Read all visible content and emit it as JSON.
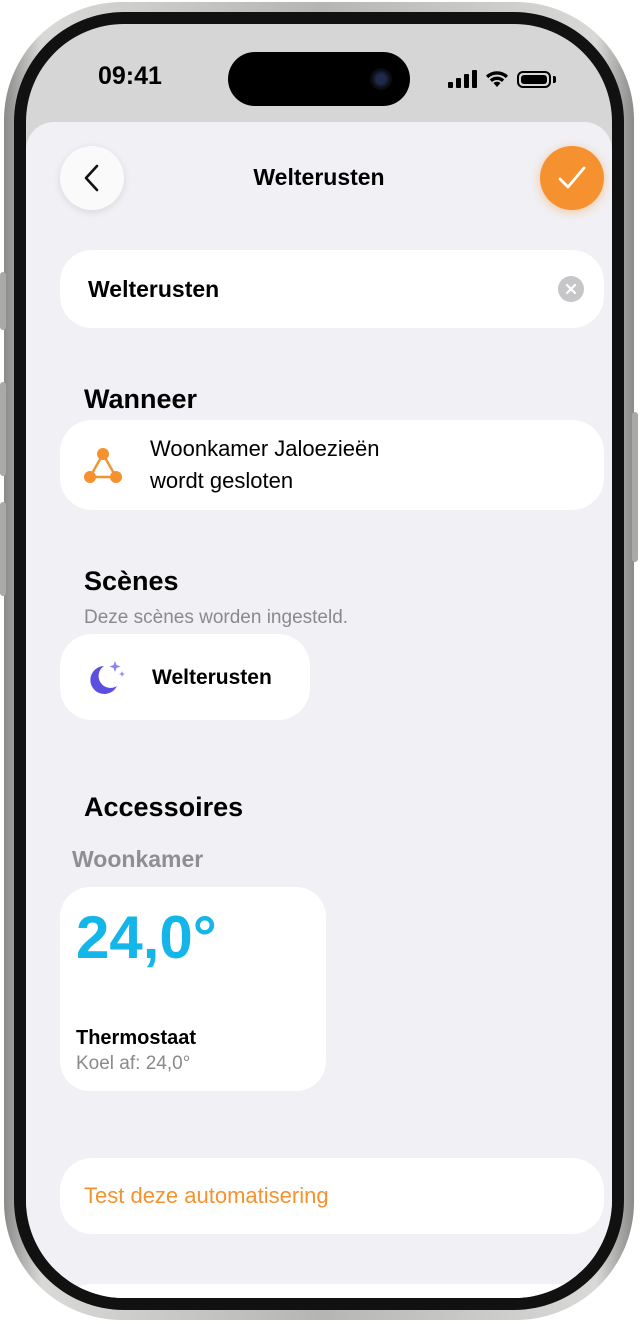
{
  "status_bar": {
    "time": "09:41"
  },
  "nav": {
    "title": "Welterusten"
  },
  "name_field": {
    "value": "Welterusten"
  },
  "when": {
    "title": "Wanneer",
    "trigger_line1": "Woonkamer Jaloezieën",
    "trigger_line2": "wordt gesloten",
    "icon": "network-triangle-icon"
  },
  "scenes": {
    "title": "Scènes",
    "subtitle": "Deze scènes worden ingesteld.",
    "items": [
      {
        "label": "Welterusten",
        "icon": "moon-stars-icon"
      }
    ]
  },
  "accessories": {
    "title": "Accessoires",
    "room": "Woonkamer",
    "items": [
      {
        "value": "24,0°",
        "name": "Thermostaat",
        "status": "Koel af: 24,0°"
      }
    ]
  },
  "actions": {
    "test_label": "Test deze automatisering"
  },
  "colors": {
    "accent": "#f5922f",
    "temperature": "#14b5e8",
    "scene_icon": "#5b4fe0",
    "background": "#f1f0f5",
    "secondary_text": "#8a8a8e"
  }
}
